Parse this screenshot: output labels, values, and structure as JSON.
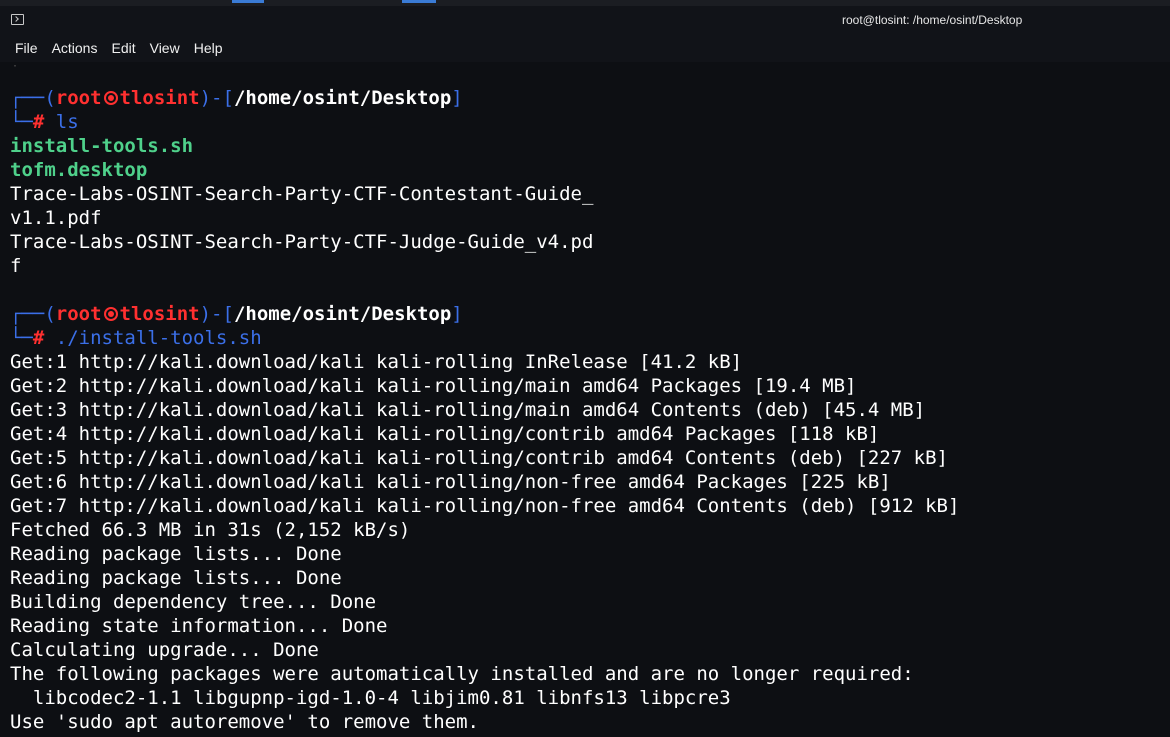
{
  "window": {
    "title": "root@tlosint: /home/osint/Desktop"
  },
  "menu": {
    "items": [
      "File",
      "Actions",
      "Edit",
      "View",
      "Help"
    ]
  },
  "icons": {
    "app": "terminal-icon",
    "prompt_separator": "skull-icon"
  },
  "colors": {
    "prompt_frame": "#3b6fe8",
    "prompt_user_host": "#ff3030",
    "executable": "#4fd18b",
    "background": "#0d0f13"
  },
  "terminal": {
    "prompts": [
      {
        "open": "┌──(",
        "user": "root",
        "host": "tlosint",
        "mid": ")-[",
        "path": "/home/osint/Desktop",
        "close": "]",
        "hash_prefix": "└─",
        "hash": "#",
        "command": " ls"
      },
      {
        "open": "┌──(",
        "user": "root",
        "host": "tlosint",
        "mid": ")-[",
        "path": "/home/osint/Desktop",
        "close": "]",
        "hash_prefix": "└─",
        "hash": "#",
        "command": " ./install-tools.sh"
      }
    ],
    "ls_output": [
      "install-tools.sh",
      "tofm.desktop",
      "Trace-Labs-OSINT-Search-Party-CTF-Contestant-Guide_",
      "v1.1.pdf",
      "Trace-Labs-OSINT-Search-Party-CTF-Judge-Guide_v4.pd",
      "f"
    ],
    "install_output": [
      "Get:1 http://kali.download/kali kali-rolling InRelease [41.2 kB]",
      "Get:2 http://kali.download/kali kali-rolling/main amd64 Packages [19.4 MB]",
      "Get:3 http://kali.download/kali kali-rolling/main amd64 Contents (deb) [45.4 MB]",
      "Get:4 http://kali.download/kali kali-rolling/contrib amd64 Packages [118 kB]",
      "Get:5 http://kali.download/kali kali-rolling/contrib amd64 Contents (deb) [227 kB]",
      "Get:6 http://kali.download/kali kali-rolling/non-free amd64 Packages [225 kB]",
      "Get:7 http://kali.download/kali kali-rolling/non-free amd64 Contents (deb) [912 kB]",
      "Fetched 66.3 MB in 31s (2,152 kB/s)",
      "Reading package lists... Done",
      "Reading package lists... Done",
      "Building dependency tree... Done",
      "Reading state information... Done",
      "Calculating upgrade... Done",
      "The following packages were automatically installed and are no longer required:",
      "  libcodec2-1.1 libgupnp-igd-1.0-4 libjim0.81 libnfs13 libpcre3",
      "Use 'sudo apt autoremove' to remove them."
    ]
  }
}
